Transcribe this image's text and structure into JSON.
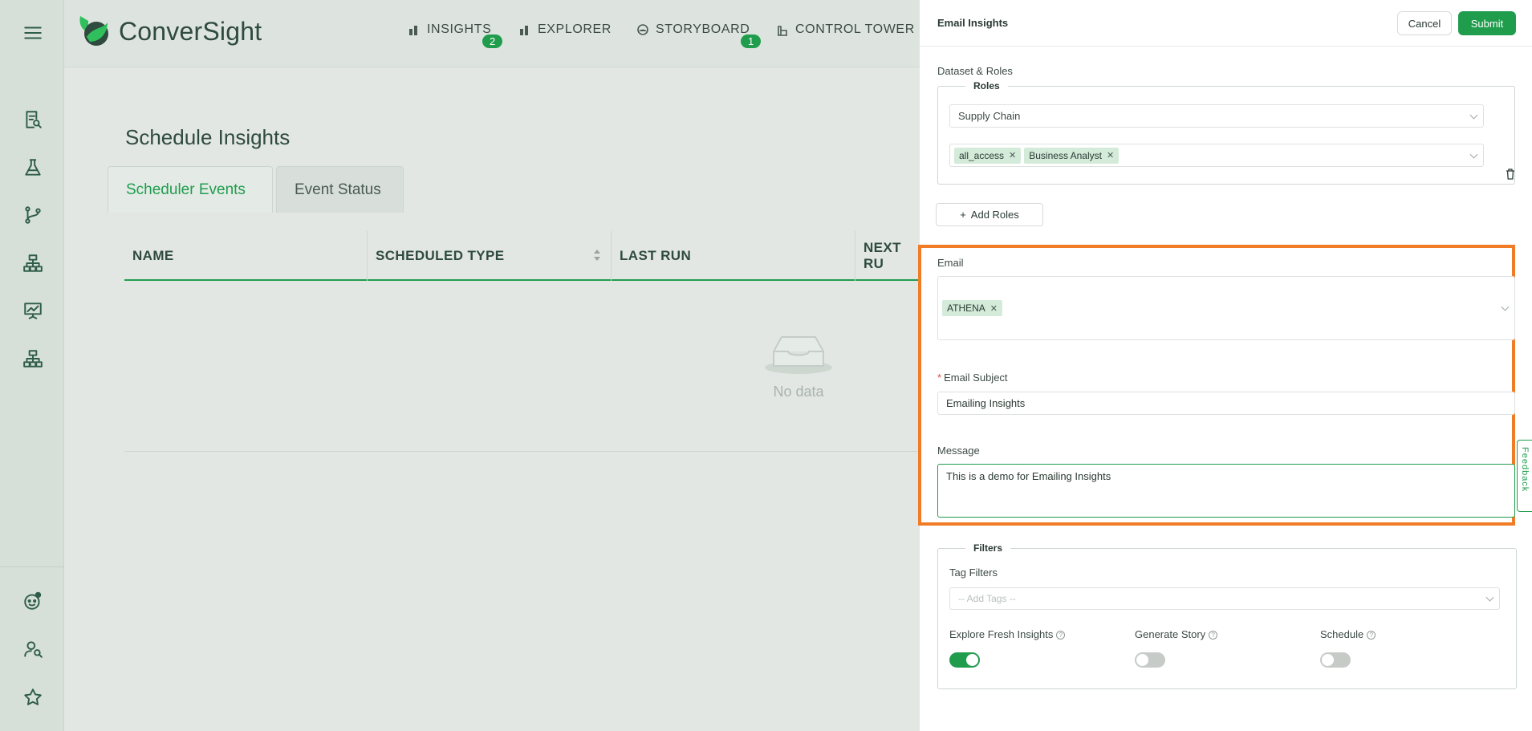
{
  "rail": {
    "icons": [
      "menu-icon",
      "report-search-icon",
      "flask-icon",
      "branch-icon",
      "hierarchy-icon",
      "presentation-chart-icon",
      "org-chart-icon",
      "bot-icon",
      "user-search-icon",
      "star-icon"
    ]
  },
  "brand": {
    "name": "ConverSight"
  },
  "nav": {
    "items": [
      {
        "label": "INSIGHTS",
        "badge": "2"
      },
      {
        "label": "EXPLORER"
      },
      {
        "label": "STORYBOARD",
        "badge": "1"
      },
      {
        "label": "CONTROL TOWER"
      }
    ]
  },
  "page": {
    "title": "Schedule Insights",
    "tabs": [
      "Scheduler Events",
      "Event Status"
    ],
    "table": {
      "columns": [
        "NAME",
        "SCHEDULED TYPE",
        "LAST RUN",
        "NEXT RU"
      ],
      "empty_text": "No data"
    }
  },
  "drawer": {
    "title": "Email Insights",
    "cancel_label": "Cancel",
    "submit_label": "Submit",
    "dataset_label": "Dataset & Roles",
    "roles_legend": "Roles",
    "dataset_value": "Supply Chain",
    "role_tags": [
      "all_access",
      "Business Analyst"
    ],
    "add_roles_label": "Add Roles",
    "email_label": "Email",
    "email_tags": [
      "ATHENA"
    ],
    "subject_label": "Email Subject",
    "subject_value": "Emailing Insights",
    "message_label": "Message",
    "message_value": "This is a demo for Emailing Insights",
    "filters_legend": "Filters",
    "tag_filters_label": "Tag Filters",
    "tag_filters_placeholder": "-- Add Tags --",
    "toggles": [
      {
        "label": "Explore Fresh Insights",
        "on": true
      },
      {
        "label": "Generate Story",
        "on": false
      },
      {
        "label": "Schedule",
        "on": false
      }
    ],
    "feedback_label": "Feedback"
  },
  "colors": {
    "accent": "#1f9d4d",
    "highlight": "#f07c27"
  }
}
